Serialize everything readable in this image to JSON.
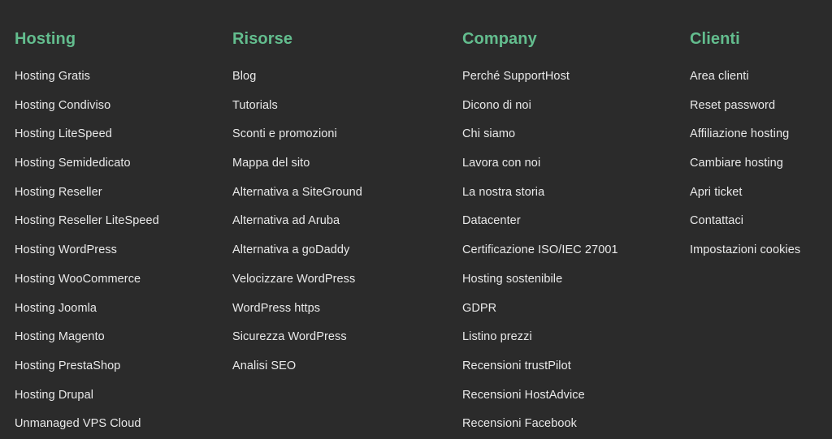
{
  "theme": {
    "background_color": "#2b2b2b",
    "heading_color": "#63bd8e",
    "link_color": "#e9e9e9"
  },
  "footer": {
    "columns": [
      {
        "heading": "Hosting",
        "links": [
          "Hosting Gratis",
          "Hosting Condiviso",
          "Hosting LiteSpeed",
          "Hosting Semidedicato",
          "Hosting Reseller",
          "Hosting Reseller LiteSpeed",
          "Hosting WordPress",
          "Hosting WooCommerce",
          "Hosting Joomla",
          "Hosting Magento",
          "Hosting PrestaShop",
          "Hosting Drupal",
          "Unmanaged VPS Cloud"
        ]
      },
      {
        "heading": "Risorse",
        "links": [
          "Blog",
          "Tutorials",
          "Sconti e promozioni",
          "Mappa del sito",
          "Alternativa a SiteGround",
          "Alternativa ad Aruba",
          "Alternativa a goDaddy",
          "Velocizzare WordPress",
          "WordPress https",
          "Sicurezza WordPress",
          "Analisi SEO"
        ]
      },
      {
        "heading": "Company",
        "links": [
          "Perché SupportHost",
          "Dicono di noi",
          "Chi siamo",
          "Lavora con noi",
          "La nostra storia",
          "Datacenter",
          "Certificazione ISO/IEC 27001",
          "Hosting sostenibile",
          "GDPR",
          "Listino prezzi",
          "Recensioni trustPilot",
          "Recensioni HostAdvice",
          "Recensioni Facebook"
        ]
      },
      {
        "heading": "Clienti",
        "links": [
          "Area clienti",
          "Reset password",
          "Affiliazione hosting",
          "Cambiare hosting",
          "Apri ticket",
          "Contattaci",
          "Impostazioni cookies"
        ]
      }
    ]
  }
}
